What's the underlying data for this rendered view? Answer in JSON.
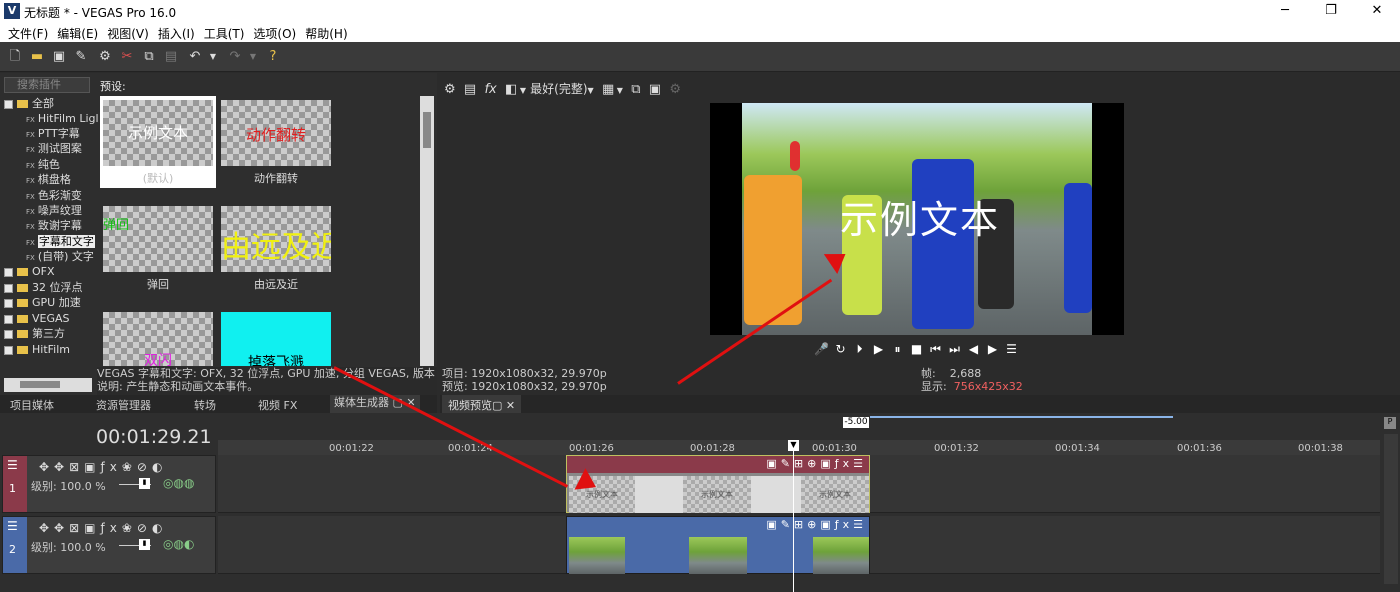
{
  "window": {
    "title": "无标题 * - VEGAS Pro 16.0",
    "app_icon": "V",
    "minimize": "─",
    "maximize": "❐",
    "close": "✕"
  },
  "menu": [
    "文件(F)",
    "编辑(E)",
    "视图(V)",
    "插入(I)",
    "工具(T)",
    "选项(O)",
    "帮助(H)"
  ],
  "plugins": {
    "search_placeholder": "搜索插件",
    "tree_root": "全部",
    "fx_items": [
      "HitFilm Ligl",
      "PTT字幕",
      "测试图案",
      "纯色",
      "棋盘格",
      "色彩渐变",
      "噪声纹理",
      "致谢字幕",
      "字幕和文字",
      "(自带) 文字"
    ],
    "folders": [
      "OFX",
      "32 位浮点",
      "GPU 加速",
      "VEGAS",
      "第三方",
      "HitFilm"
    ],
    "selected": "字幕和文字"
  },
  "presets": {
    "label": "预设:",
    "items": [
      {
        "thumb_text": "示例文本",
        "caption": "(默认)",
        "thumb_color": "#ffffff"
      },
      {
        "thumb_text": "动作翻转",
        "caption": "动作翻转",
        "thumb_color": "#e02020"
      },
      {
        "thumb_text": "弹回",
        "caption": "弹回",
        "thumb_color": "#10c010"
      },
      {
        "thumb_text": "由远及近",
        "caption": "由远及近",
        "thumb_color": "#f0f010"
      },
      {
        "thumb_text": "双闪",
        "caption": "",
        "thumb_color": "#e020e0"
      },
      {
        "thumb_text": "掉落飞溅",
        "caption": "",
        "thumb_color": "#000000"
      }
    ]
  },
  "plugin_info": {
    "line1": "VEGAS 字幕和文字: OFX, 32 位浮点, GPU 加速, 分组 VEGAS, 版本",
    "line2": "说明: 产生静态和动画文本事件。"
  },
  "left_tabs": [
    "项目媒体",
    "资源管理器",
    "转场",
    "视频 FX",
    "媒体生成器"
  ],
  "preview": {
    "quality": "最好(完整)",
    "overlay_text": "示例文本",
    "project_label": "项目:",
    "project_value": "1920x1080x32, 29.970p",
    "preview_label": "预览:",
    "preview_value": "1920x1080x32, 29.970p",
    "frame_label": "帧:",
    "frame_value": "2,688",
    "display_label": "显示:",
    "display_value": "756x425x32",
    "tab": "视频预览"
  },
  "timeline": {
    "timecode": "00:01:29.21",
    "rate": "-5.00",
    "ruler": [
      "00:01:22",
      "00:01:24",
      "00:01:26",
      "00:01:28",
      "00:01:30",
      "00:01:32",
      "00:01:34",
      "00:01:36",
      "00:01:38"
    ],
    "tracks": [
      {
        "number": "1",
        "level_label": "级别:",
        "level_value": "100.0 %",
        "color": "#8b3a4a"
      },
      {
        "number": "2",
        "level_label": "级别:",
        "level_value": "100.0 %",
        "color": "#4a6aa8"
      }
    ],
    "event_text": "示例文本"
  },
  "colors": {
    "accent_red": "#e01010",
    "track1": "#8b3a4a",
    "track2": "#4a6aa8",
    "display_value": "#f06060"
  }
}
